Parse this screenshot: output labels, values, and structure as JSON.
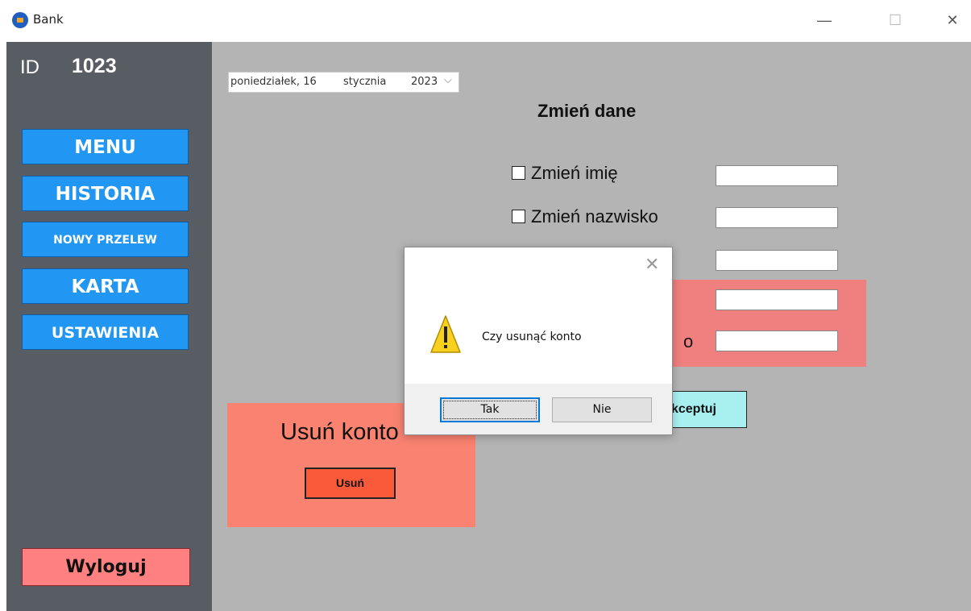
{
  "window": {
    "title": "Bank",
    "minimize": "—",
    "maximize": "☐",
    "close": "✕"
  },
  "sidebar": {
    "id_label": "ID",
    "id_value": "1023",
    "items": [
      {
        "label": "MENU"
      },
      {
        "label": "HISTORIA"
      },
      {
        "label": "NOWY PRZELEW"
      },
      {
        "label": "KARTA"
      },
      {
        "label": "USTAWIENIA"
      }
    ],
    "logout_label": "Wyloguj"
  },
  "date_picker": {
    "weekday": "poniedziałek, 16",
    "month": "stycznia",
    "year": "2023",
    "arrow": "⌵"
  },
  "change_data": {
    "title": "Zmień dane",
    "options": [
      {
        "label": "Zmień imię"
      },
      {
        "label": "Zmień nazwisko"
      }
    ],
    "partial_label": "o",
    "accept_label": "kceptuj"
  },
  "delete_account": {
    "title": "Usuń konto",
    "button_label": "Usuń"
  },
  "dialog": {
    "close": "✕",
    "message": "Czy usunąć konto",
    "icon": "warning-icon",
    "yes_label": "Tak",
    "no_label": "Nie"
  },
  "colors": {
    "sidebar": "#585c63",
    "nav_button": "#2196f3",
    "main_bg": "#b4b4b4",
    "logout": "#ff8080",
    "delete_panel": "#f98270",
    "accept_button": "#a8f0f0"
  }
}
